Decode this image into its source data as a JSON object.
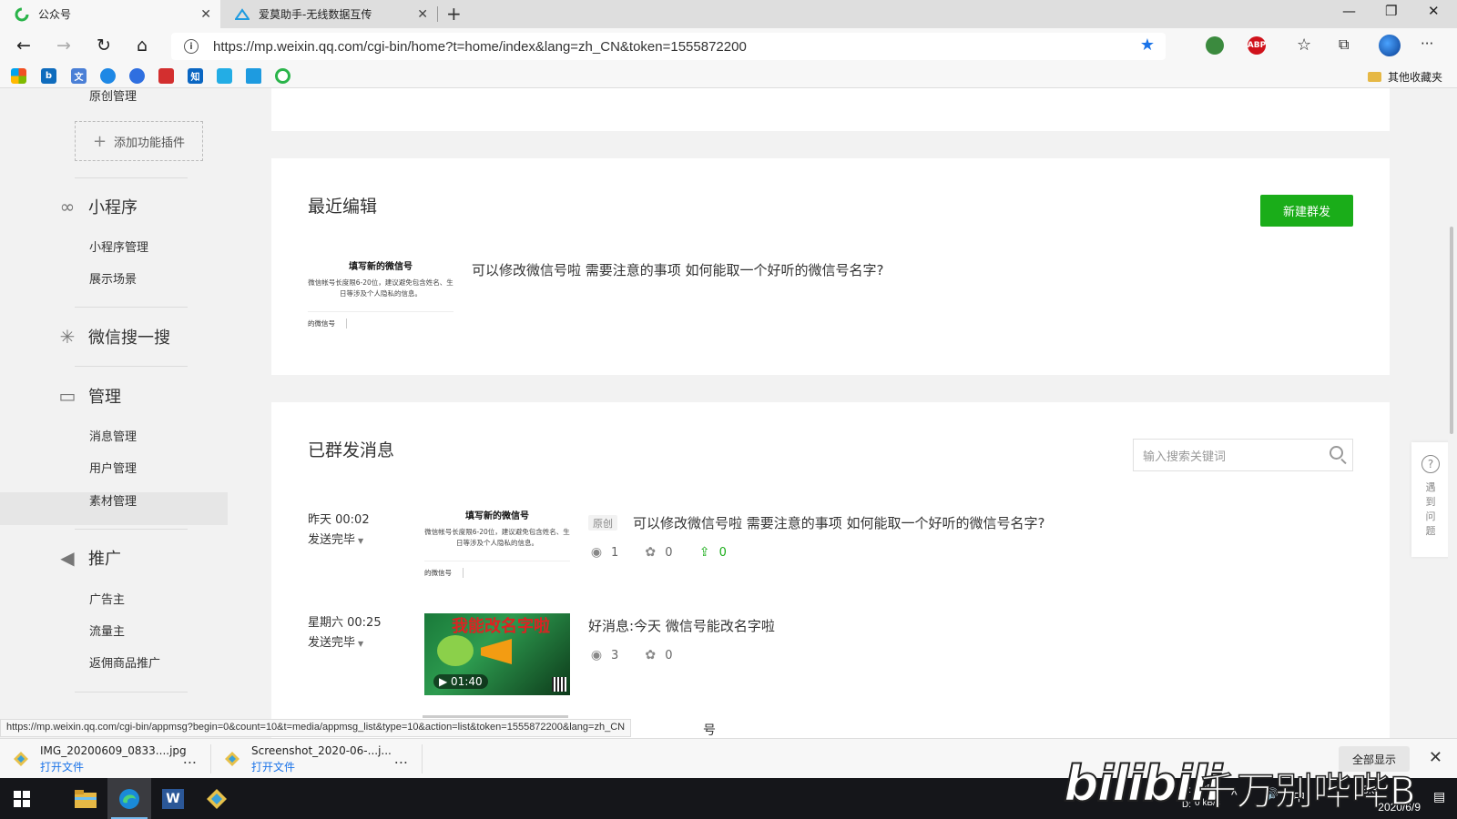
{
  "browser": {
    "tabs": [
      {
        "title": "公众号",
        "active": true
      },
      {
        "title": "爱莫助手-无线数据互传",
        "active": false
      }
    ],
    "new_tab": "+",
    "close_glyph": "✕",
    "window_controls": {
      "minimize": "—",
      "maximize": "❐",
      "close": "✕"
    },
    "nav": {
      "back": "←",
      "forward": "→",
      "refresh": "↻",
      "home": "⌂"
    },
    "address": {
      "url": "https://mp.weixin.qq.com/cgi-bin/home?t=home/index&lang=zh_CN&token=1555872200",
      "info": "i",
      "star": "★"
    },
    "extensions": [
      {
        "icon": "globe-extension-icon",
        "label": "",
        "color": "#3b8a3e"
      },
      {
        "icon": "adblock-plus-icon",
        "label": "ABP",
        "color": "#d0121b"
      }
    ],
    "toolbar_glyphs": {
      "favorites": "☆",
      "collections": "⧉",
      "more": "···"
    },
    "bookmarks": [
      {
        "icon": "windows-bookmark-icon",
        "label": "",
        "color": "#f25022"
      },
      {
        "icon": "bing-bookmark-icon",
        "label": "b",
        "color": "#0f6cbd"
      },
      {
        "icon": "translate-bookmark-icon",
        "label": "文",
        "color": "#4a7fd6"
      },
      {
        "icon": "cloud-bookmark-icon",
        "label": "",
        "color": "#1e88e5"
      },
      {
        "icon": "baidu-bookmark-icon",
        "label": "",
        "color": "#2f6fe0"
      },
      {
        "icon": "news-bookmark-icon",
        "label": "",
        "color": "#d32f2f"
      },
      {
        "icon": "zhihu-bookmark-icon",
        "label": "知",
        "color": "#0a66c2"
      },
      {
        "icon": "bilibili-bookmark-icon",
        "label": "",
        "color": "#23ade5"
      },
      {
        "icon": "aimo-bookmark-icon",
        "label": "",
        "color": "#1e9be0"
      },
      {
        "icon": "wechat-mp-bookmark-icon",
        "label": "",
        "color": "#2ab44a"
      }
    ],
    "other_bookmarks": "其他收藏夹"
  },
  "sidebar": {
    "top_item": "原创管理",
    "add_plugin": "添加功能插件",
    "add_plugin_plus": "+",
    "groups": [
      {
        "icon": "mini-program-icon",
        "glyph": "∞",
        "label": "小程序",
        "items": [
          "小程序管理",
          "展示场景"
        ]
      },
      {
        "icon": "wechat-search-icon",
        "glyph": "✳",
        "label": "微信搜一搜",
        "items": []
      },
      {
        "icon": "manage-icon",
        "glyph": "▭",
        "label": "管理",
        "items": [
          "消息管理",
          "用户管理",
          "素材管理"
        ]
      },
      {
        "icon": "promotion-megaphone-icon",
        "glyph": "◀",
        "label": "推广",
        "items": [
          "广告主",
          "流量主",
          "返佣商品推广"
        ]
      }
    ],
    "active_item": "素材管理"
  },
  "recent": {
    "title": "最近编辑",
    "new_button": "新建群发",
    "article": {
      "thumb_title": "填写新的微信号",
      "thumb_desc": "微信帐号长度限6-20位，建议避免包含姓名、生日等涉及个人隐私的信息。",
      "thumb_foot": "的微信号",
      "title": "可以修改微信号啦 需要注意的事项 如何能取一个好听的微信号名字?"
    }
  },
  "sent": {
    "title": "已群发消息",
    "search_placeholder": "输入搜索关键词",
    "messages": [
      {
        "time": "昨天 00:02",
        "status": "发送完毕",
        "badge": "原创",
        "title": "可以修改微信号啦 需要注意的事项 如何能取一个好听的微信号名字?",
        "thumb_title": "填写新的微信号",
        "thumb_desc": "微信帐号长度限6-20位，建议避免包含姓名、生日等涉及个人隐私的信息。",
        "thumb_foot": "的微信号",
        "reads": "1",
        "likes": "0",
        "shares": "0"
      },
      {
        "time": "星期六 00:25",
        "status": "发送完毕",
        "title": "好消息:今天 微信号能改名字啦",
        "video_banner": "我能改名字啦",
        "duration": "01:40",
        "reads": "3",
        "likes": "0"
      }
    ]
  },
  "help": {
    "glyph": "?",
    "label": "遇到问题"
  },
  "status_url": "https://mp.weixin.qq.com/cgi-bin/appmsg?begin=0&count=10&t=media/appmsg_list&type=10&action=list&token=1555872200&lang=zh_CN",
  "peek_text": "号",
  "downloads": {
    "items": [
      {
        "name": "IMG_20200609_0833....jpg",
        "action": "打开文件"
      },
      {
        "name": "Screenshot_2020-06-...j...",
        "action": "打开文件"
      }
    ],
    "more": "...",
    "show_all": "全部显示",
    "close": "✕"
  },
  "taskbar": {
    "net_up": "0 kB/s",
    "net_down": "0 kB/s",
    "time": "8:3",
    "date": "2020/6/9",
    "tray_up": "U:",
    "tray_down": "D:",
    "tray_glyphs": {
      "caret": "^",
      "ime": "中",
      "volume": "🔊",
      "notify": "▤"
    },
    "apps": [
      {
        "icon": "windows-start-icon"
      },
      {
        "icon": "file-explorer-icon"
      },
      {
        "icon": "edge-browser-icon",
        "active": true
      },
      {
        "icon": "word-icon",
        "label": "W"
      },
      {
        "icon": "aimo-assistant-icon"
      }
    ]
  },
  "watermark": {
    "logo": "bilibili",
    "text": "千万别哔哔B"
  }
}
